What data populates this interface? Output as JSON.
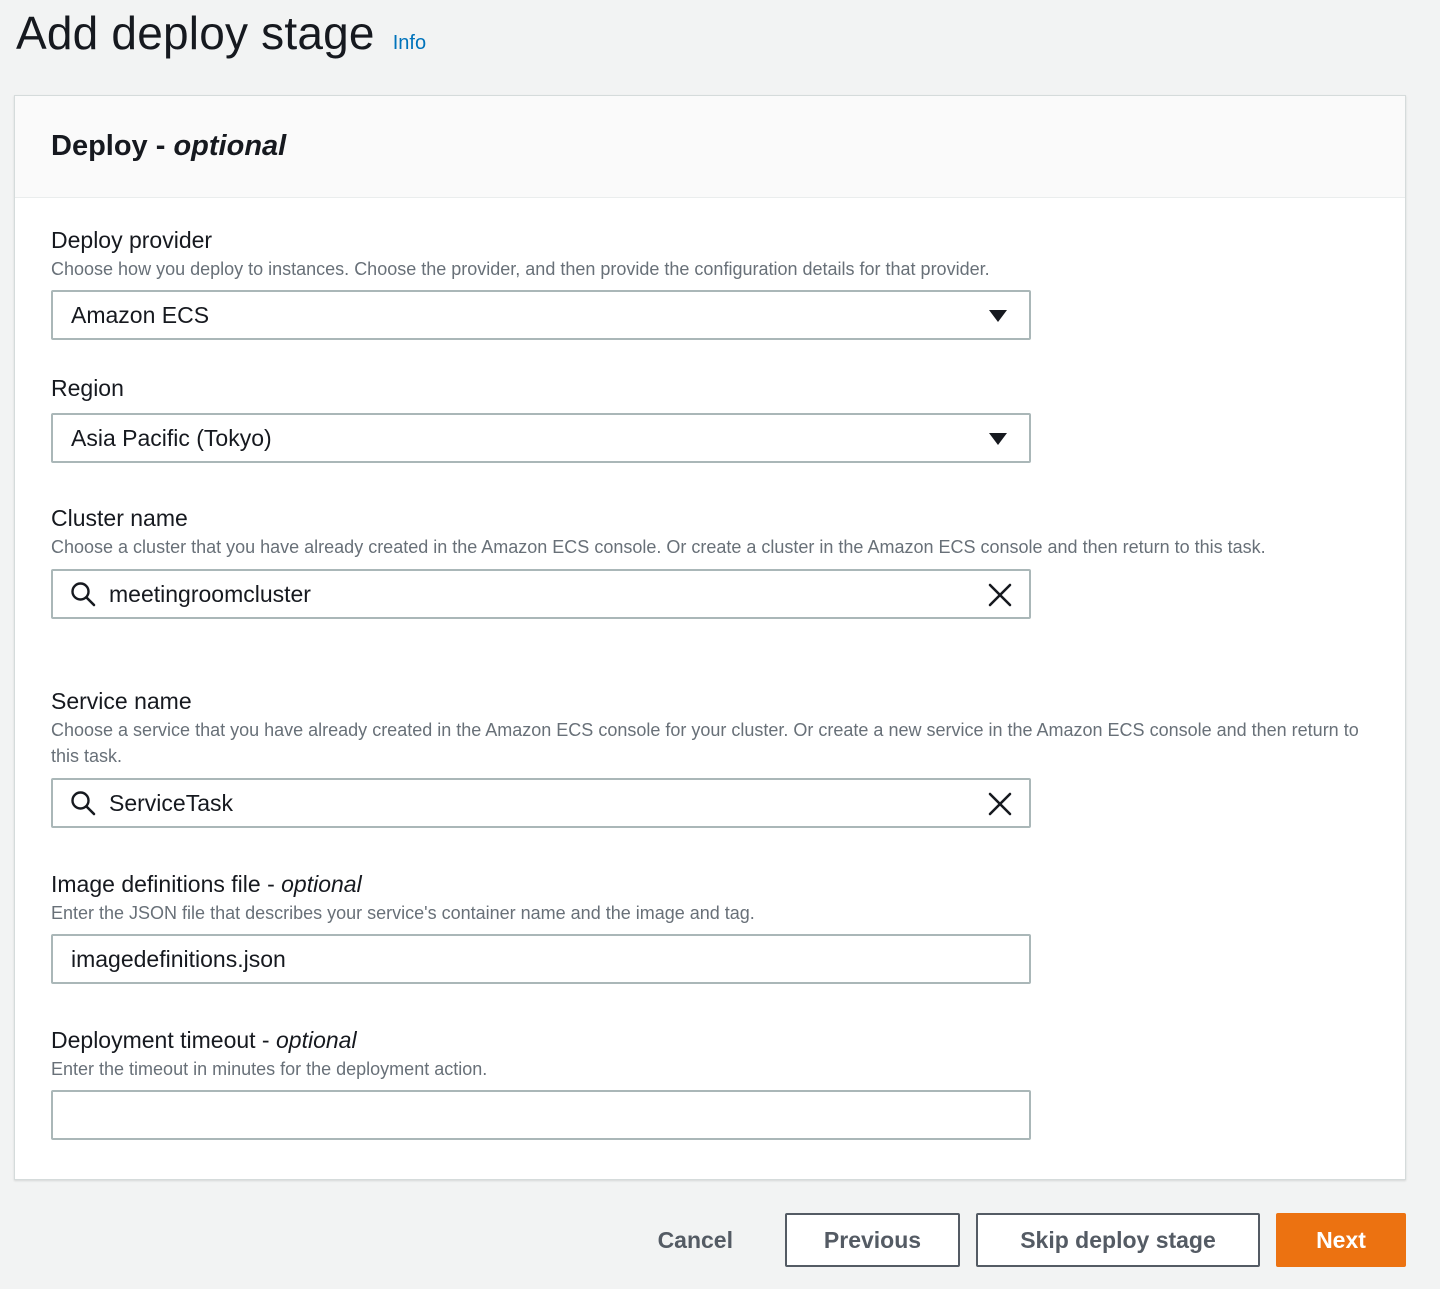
{
  "header": {
    "title": "Add deploy stage",
    "info_link": "Info"
  },
  "panel": {
    "title": "Deploy - ",
    "title_optional": "optional"
  },
  "fields": {
    "deploy_provider": {
      "label": "Deploy provider",
      "description": "Choose how you deploy to instances. Choose the provider, and then provide the configuration details for that provider.",
      "value": "Amazon ECS"
    },
    "region": {
      "label": "Region",
      "value": "Asia Pacific (Tokyo)"
    },
    "cluster_name": {
      "label": "Cluster name",
      "description": "Choose a cluster that you have already created in the Amazon ECS console. Or create a cluster in the Amazon ECS console and then return to this task.",
      "value": "meetingroomcluster"
    },
    "service_name": {
      "label": "Service name",
      "description": "Choose a service that you have already created in the Amazon ECS console for your cluster. Or create a new service in the Amazon ECS console and then return to this task.",
      "value": "ServiceTask"
    },
    "image_definitions": {
      "label": "Image definitions file - ",
      "label_optional": "optional",
      "description": "Enter the JSON file that describes your service's container name and the image and tag.",
      "value": "imagedefinitions.json"
    },
    "deployment_timeout": {
      "label": "Deployment timeout - ",
      "label_optional": "optional",
      "description": "Enter the timeout in minutes for the deployment action.",
      "value": ""
    }
  },
  "footer": {
    "cancel": "Cancel",
    "previous": "Previous",
    "skip": "Skip deploy stage",
    "next": "Next"
  },
  "colors": {
    "primary": "#ec7211",
    "link": "#0073bb",
    "background": "#f2f3f3",
    "border": "#aab7b8"
  },
  "icons": {
    "select": "caret-down-icon",
    "search": "search-icon",
    "clear": "close-icon"
  }
}
